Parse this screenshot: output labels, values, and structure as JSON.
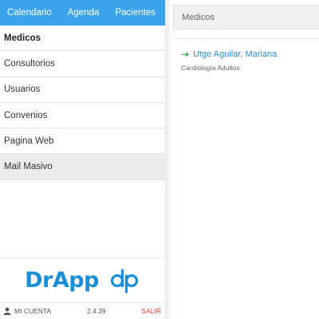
{
  "topnav": {
    "calendar": "Calendario",
    "agenda": "Agenda",
    "patients": "Pacientes"
  },
  "menu": {
    "items": [
      {
        "label": "Medicos"
      },
      {
        "label": "Consultorios"
      },
      {
        "label": "Usuarios"
      },
      {
        "label": "Convenios"
      },
      {
        "label": "Pagina Web"
      },
      {
        "label": "Mail Masivo"
      }
    ]
  },
  "brand": {
    "name": "DrApp",
    "mark": "dp"
  },
  "footer": {
    "account": "MI CUENTA",
    "version": "2.4.39",
    "logout": "SALIR"
  },
  "main": {
    "title": "Medicos",
    "doctors": [
      {
        "name": "Utge Aguilar, Mariana",
        "specialty": "Cardiología Adultos"
      }
    ]
  },
  "colors": {
    "nav": "#3aa3ec",
    "link": "#2a8fd6",
    "arrow": "#2aa04a",
    "logout": "#e53935",
    "brand": "#1a8fd9"
  },
  "icons": {
    "account": "user-icon",
    "doctor_arrow": "arrow-right-icon"
  }
}
